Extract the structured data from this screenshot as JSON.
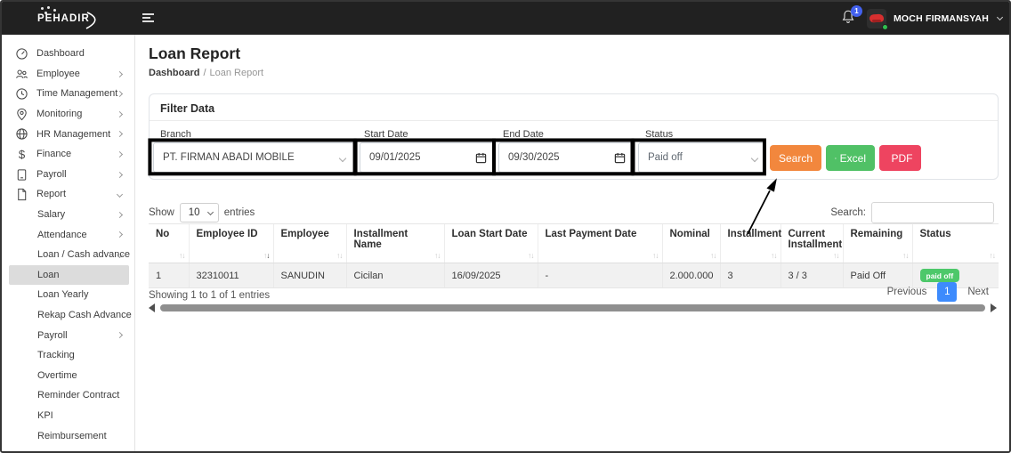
{
  "brand": {
    "name": "PEHADIR"
  },
  "topbar": {
    "notification_count": "1",
    "username": "MOCH FIRMANSYAH"
  },
  "sidebar": {
    "items": [
      {
        "label": "Dashboard",
        "icon": "dashboard-gauge"
      },
      {
        "label": "Employee",
        "icon": "people"
      },
      {
        "label": "Time Management",
        "icon": "clock"
      },
      {
        "label": "Monitoring",
        "icon": "location-pin"
      },
      {
        "label": "HR Management",
        "icon": "globe"
      },
      {
        "label": "Finance",
        "icon": "dollar"
      },
      {
        "label": "Payroll",
        "icon": "ledger"
      },
      {
        "label": "Report",
        "icon": "document"
      }
    ],
    "report_items": [
      {
        "label": "Salary"
      },
      {
        "label": "Attendance"
      },
      {
        "label": "Loan / Cash advance"
      },
      {
        "label": "Loan",
        "active": true
      },
      {
        "label": "Loan Yearly"
      },
      {
        "label": "Rekap Cash Advance"
      },
      {
        "label": "Payroll"
      },
      {
        "label": "Tracking"
      },
      {
        "label": "Overtime"
      },
      {
        "label": "Reminder Contract"
      },
      {
        "label": "KPI"
      },
      {
        "label": "Reimbursement"
      }
    ]
  },
  "page": {
    "title": "Loan Report",
    "breadcrumb_home": "Dashboard",
    "breadcrumb_sep": "/",
    "breadcrumb_current": "Loan Report"
  },
  "filter": {
    "title": "Filter Data",
    "branch_label": "Branch",
    "branch_value": "PT. FIRMAN ABADI MOBILE",
    "start_label": "Start Date",
    "start_value": "09/01/2025",
    "end_label": "End Date",
    "end_value": "09/30/2025",
    "status_label": "Status",
    "status_value": "Paid off",
    "search_button": "Search",
    "excel_button": "Excel",
    "pdf_button": "PDF"
  },
  "table": {
    "show_label": "Show",
    "page_size": "10",
    "entries_label": "entries",
    "search_label": "Search:",
    "headers": [
      "No",
      "Employee ID",
      "Employee",
      "Installment Name",
      "Loan Start Date",
      "Last Payment Date",
      "Nominal",
      "Installment",
      "Current Installment",
      "Remaining",
      "Status"
    ],
    "rows": [
      {
        "no": "1",
        "employee_id": "32310011",
        "employee": "SANUDIN",
        "installment_name": "Cicilan",
        "loan_start_date": "16/09/2025",
        "last_payment_date": "-",
        "nominal": "2.000.000",
        "installment": "3",
        "current_installment": "3 / 3",
        "remaining": "Paid Off",
        "status_badge": "paid off"
      }
    ],
    "info": "Showing 1 to 1 of 1 entries",
    "pagination": {
      "previous": "Previous",
      "page": "1",
      "next": "Next"
    }
  },
  "colors": {
    "topbar": "#212121",
    "search_button": "#f2873d",
    "excel_button": "#50c166",
    "pdf_button": "#ee4460",
    "status_badge": "#4dc86a",
    "active_page": "#3d8bfd",
    "notification_badge": "#4361ee",
    "annotation": "#000000"
  }
}
